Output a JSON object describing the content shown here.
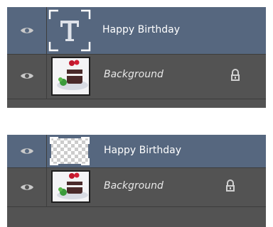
{
  "layers_panel_before": {
    "layers": [
      {
        "name": "Happy Birthday",
        "kind": "type-layer",
        "selected": true,
        "locked": false
      },
      {
        "name": "Background",
        "kind": "image-layer",
        "selected": false,
        "locked": true
      }
    ]
  },
  "layers_panel_after": {
    "layers": [
      {
        "name": "Happy Birthday",
        "kind": "transparent-pixel-layer",
        "selected": true,
        "locked": false
      },
      {
        "name": "Background",
        "kind": "image-layer",
        "selected": false,
        "locked": true
      }
    ]
  },
  "colors": {
    "panel_bg": "#535353",
    "selected_row_bg": "#56677f",
    "text": "#ffffff"
  },
  "icons": {
    "visibility": "eye-icon",
    "lock": "lock-icon",
    "type_thumbnail": "type-layer-icon"
  }
}
